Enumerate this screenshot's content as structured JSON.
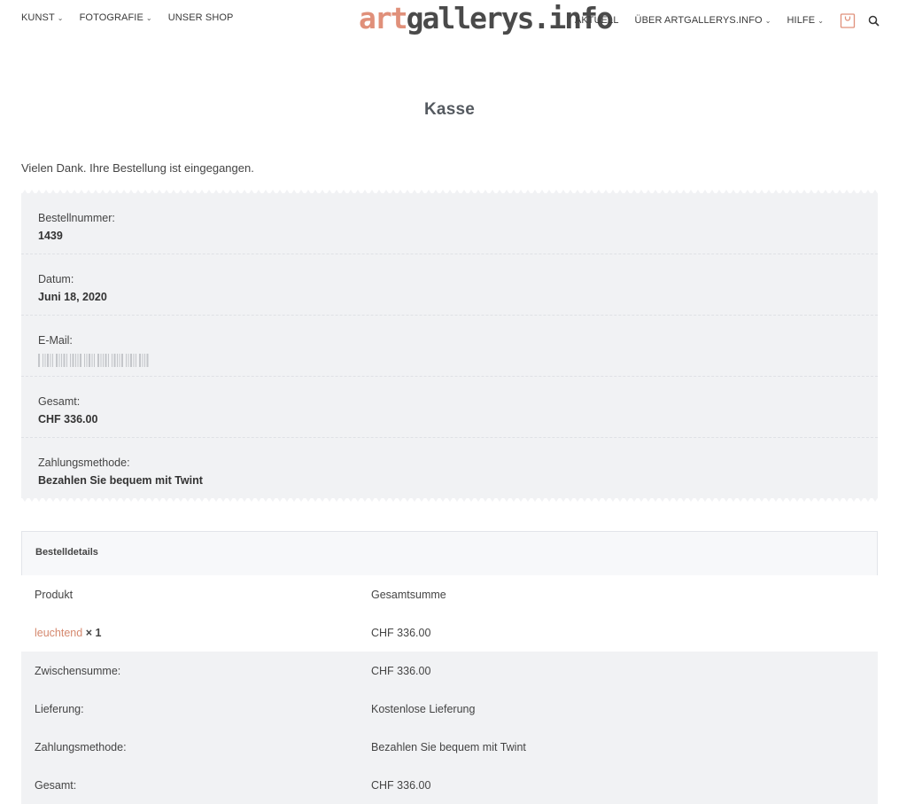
{
  "header": {
    "logo_art": "art",
    "logo_rest": "gallerys.info",
    "nav_left": [
      {
        "label": "KUNST",
        "has_dropdown": true
      },
      {
        "label": "FOTOGRAFIE",
        "has_dropdown": true
      },
      {
        "label": "UNSER SHOP",
        "has_dropdown": false
      }
    ],
    "nav_right": [
      {
        "label": "AKTUELL",
        "has_dropdown": false
      },
      {
        "label": "ÜBER ARTGALLERYS.INFO",
        "has_dropdown": true
      },
      {
        "label": "HILFE",
        "has_dropdown": true
      }
    ],
    "cart_icon": "shopping-bag-icon",
    "search_icon": "search-icon",
    "accent_color": "#e0907a"
  },
  "page": {
    "title": "Kasse",
    "thanks": "Vielen Dank. Ihre Bestellung ist eingegangen."
  },
  "overview": [
    {
      "label": "Bestellnummer:",
      "value": "1439"
    },
    {
      "label": "Datum:",
      "value": "Juni 18, 2020"
    },
    {
      "label": "E-Mail:",
      "value": ""
    },
    {
      "label": "Gesamt:",
      "value": "CHF 336.00"
    },
    {
      "label": "Zahlungsmethode:",
      "value": "Bezahlen Sie bequem mit Twint"
    }
  ],
  "details": {
    "heading": "Bestelldetails",
    "col_product": "Produkt",
    "col_total": "Gesamtsumme",
    "item_name": "leuchtend",
    "item_qty": "× 1",
    "item_total": "CHF 336.00",
    "rows": [
      {
        "label": "Zwischensumme:",
        "value": "CHF 336.00"
      },
      {
        "label": "Lieferung:",
        "value": "Kostenlose Lieferung"
      },
      {
        "label": "Zahlungsmethode:",
        "value": "Bezahlen Sie bequem mit Twint"
      },
      {
        "label": "Gesamt:",
        "value": "CHF 336.00"
      }
    ]
  }
}
